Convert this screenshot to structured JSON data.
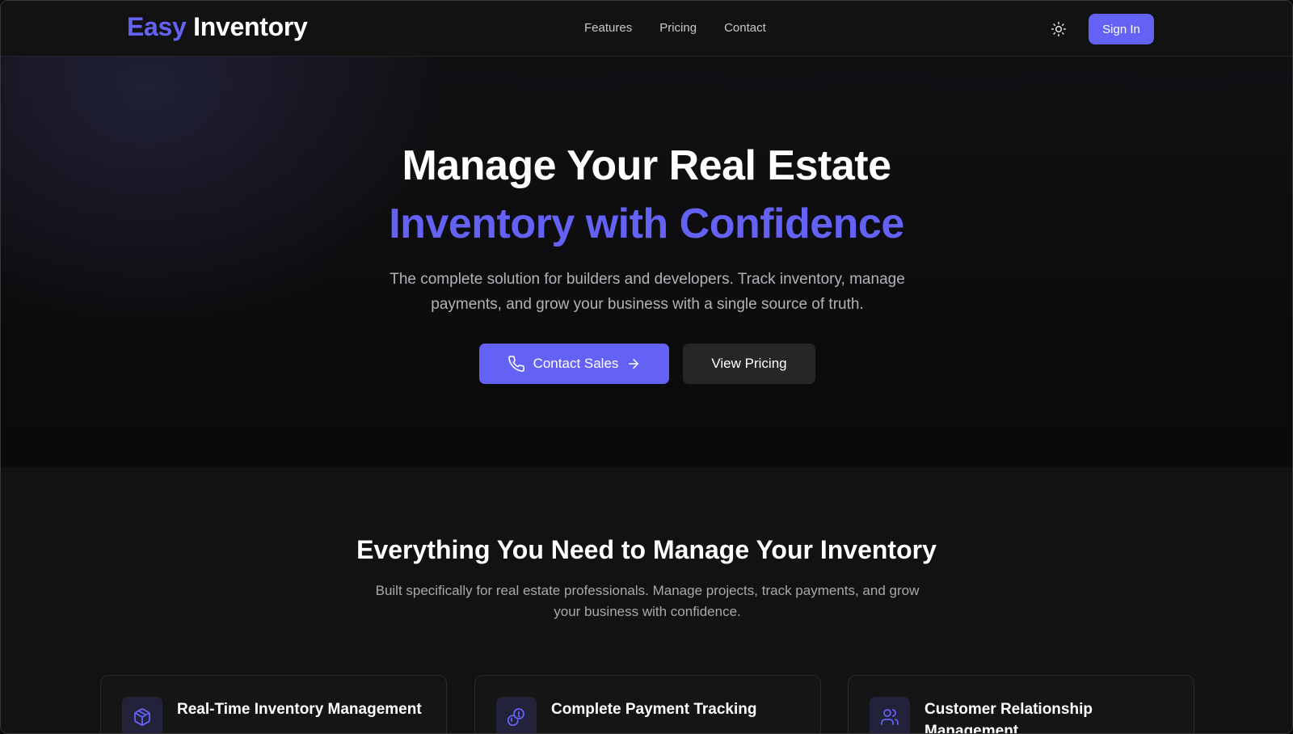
{
  "brand": {
    "part1": "Easy",
    "part2": "Inventory"
  },
  "nav": {
    "links": [
      {
        "label": "Features"
      },
      {
        "label": "Pricing"
      },
      {
        "label": "Contact"
      }
    ],
    "theme_icon": "sun-icon",
    "signin_label": "Sign In"
  },
  "hero": {
    "title_line1": "Manage Your Real Estate",
    "title_line2": "Inventory with Confidence",
    "subtitle": "The complete solution for builders and developers. Track inventory, manage payments, and grow your business with a single source of truth.",
    "primary_cta": {
      "label": "Contact Sales",
      "icon": "phone-icon",
      "trailing_icon": "arrow-right-icon"
    },
    "secondary_cta": {
      "label": "View Pricing"
    }
  },
  "features": {
    "title": "Everything You Need to Manage Your Inventory",
    "subtitle": "Built specifically for real estate professionals. Manage projects, track payments, and grow your business with confidence.",
    "cards": [
      {
        "title": "Real-Time Inventory Management",
        "icon": "package-icon"
      },
      {
        "title": "Complete Payment Tracking",
        "icon": "coins-icon"
      },
      {
        "title": "Customer Relationship Management",
        "icon": "users-icon"
      }
    ]
  },
  "colors": {
    "accent": "#6462f5",
    "background": "#0b0b0c",
    "surface": "#121213",
    "muted_text": "#b3b3b7"
  }
}
